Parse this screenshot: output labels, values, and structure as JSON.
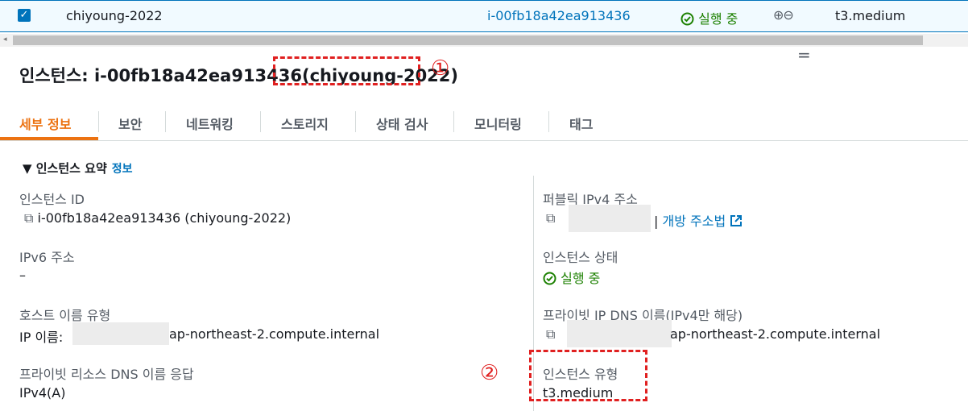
{
  "instance_row": {
    "checkbox": "✓",
    "name": "chiyoung-2022",
    "instance_id": "i-00fb18a42ea913436",
    "status": "실행 중",
    "status_icon": "check-circle-icon",
    "zoom_in": "⊕",
    "zoom_out": "⊖",
    "instance_type": "t3.medium"
  },
  "scrollbar": {
    "left_arrow": "◂"
  },
  "drag_handle": "=",
  "heading": {
    "prefix": "인스턴스: i-00fb18a42ea913436",
    "name_part": "(chiyoung-2022)",
    "annotation_1": "①",
    "annotation_2": "②"
  },
  "tabs": [
    "세부 정보",
    "보안",
    "네트워킹",
    "스토리지",
    "상태 검사",
    "모니터링",
    "태그"
  ],
  "summary": {
    "title": "▼ 인스턴스 요약",
    "info_link": "정보",
    "instance_id_label": "인스턴스 ID",
    "instance_id_value": "i-00fb18a42ea913436 (chiyoung-2022)",
    "ipv6_label": "IPv6 주소",
    "ipv6_value": "–",
    "hostname_type_label": "호스트 이름 유형",
    "hostname_type_prefix": "IP 이름:",
    "hostname_type_suffix": "ap-northeast-2.compute.internal",
    "private_dns_answer_label": "프라이빗 리소스 DNS 이름 응답",
    "private_dns_answer_value": "IPv4(A)",
    "public_ipv4_label": "퍼블릭 IPv4 주소",
    "public_ipv4_separator": "|",
    "open_address_link": "개방 주소법",
    "instance_state_label": "인스턴스 상태",
    "instance_state_value": "실행 중",
    "private_ip_dns_label": "프라이빗 IP DNS 이름(IPv4만 해당)",
    "private_ip_dns_suffix": "ap-northeast-2.compute.internal",
    "instance_type_label": "인스턴스 유형",
    "instance_type_value": "t3.medium"
  },
  "colors": {
    "accent": "#0073bb",
    "active_tab": "#ec7211",
    "success": "#1d8102",
    "annotation": "#e02020"
  }
}
